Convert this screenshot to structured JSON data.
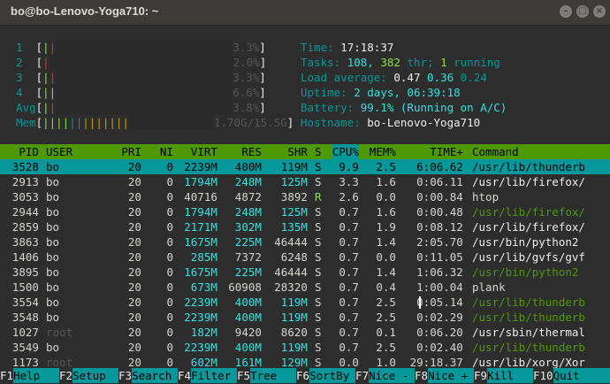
{
  "window": {
    "title": "bo@bo-Lenovo-Yoga710: ~"
  },
  "meters": {
    "cpu1": {
      "label": "1",
      "value": "3.3%"
    },
    "cpu2": {
      "label": "2",
      "value": "2.0%"
    },
    "cpu3": {
      "label": "3",
      "value": "3.3%"
    },
    "cpu4": {
      "label": "4",
      "value": "6.6%"
    },
    "avg": {
      "label": "Avg",
      "value": "3.8%"
    },
    "mem": {
      "label": "Mem",
      "value": "1.70G/15.5G"
    }
  },
  "info": {
    "time_label": "Time:",
    "time": "17:18:37",
    "tasks_label": "Tasks:",
    "tasks": "108,",
    "thr": "382",
    "thr_label": "thr;",
    "running": "1",
    "running_label": "running",
    "load_label": "Load average:",
    "load1": "0.47",
    "load5": "0.36",
    "load15": "0.24",
    "uptime_label": "Uptime:",
    "uptime": "2 days, 06:39:18",
    "battery_label": "Battery:",
    "battery": "99.1% (Running on A/C)",
    "host_label": "Hostname:",
    "host": "bo-Lenovo-Yoga710"
  },
  "table": {
    "headers": [
      "PID",
      "USER",
      "PRI",
      "NI",
      "VIRT",
      "RES",
      "SHR",
      "S",
      "CPU%",
      "MEM%",
      "TIME+",
      "Command"
    ],
    "rows": [
      [
        "3528",
        "bo",
        "20",
        "0",
        "2239M",
        "400M",
        "119M",
        "S",
        "9.9",
        "2.5",
        "6:06.62",
        "/usr/lib/thunderb"
      ],
      [
        "2913",
        "bo",
        "20",
        "0",
        "1794M",
        "248M",
        "125M",
        "S",
        "3.3",
        "1.6",
        "0:06.11",
        "/usr/lib/firefox/"
      ],
      [
        "3053",
        "bo",
        "20",
        "0",
        "40716",
        "4872",
        "3892",
        "R",
        "2.6",
        "0.0",
        "0:00.84",
        "htop"
      ],
      [
        "2944",
        "bo",
        "20",
        "0",
        "1794M",
        "248M",
        "125M",
        "S",
        "0.7",
        "1.6",
        "0:00.48",
        "/usr/lib/firefox/"
      ],
      [
        "2859",
        "bo",
        "20",
        "0",
        "2171M",
        "302M",
        "135M",
        "S",
        "0.7",
        "1.9",
        "0:08.12",
        "/usr/lib/firefox/"
      ],
      [
        "3863",
        "bo",
        "20",
        "0",
        "1675M",
        "225M",
        "46444",
        "S",
        "0.7",
        "1.4",
        "2:05.70",
        "/usr/bin/python2"
      ],
      [
        "1406",
        "bo",
        "20",
        "0",
        "285M",
        "7372",
        "6248",
        "S",
        "0.7",
        "0.0",
        "0:11.05",
        "/usr/lib/gvfs/gvf"
      ],
      [
        "3895",
        "bo",
        "20",
        "0",
        "1675M",
        "225M",
        "46444",
        "S",
        "0.7",
        "1.4",
        "1:06.32",
        "/usr/bin/python2"
      ],
      [
        "1500",
        "bo",
        "20",
        "0",
        "673M",
        "60908",
        "28320",
        "S",
        "0.7",
        "0.4",
        "1:00.04",
        "plank"
      ],
      [
        "3554",
        "bo",
        "20",
        "0",
        "2239M",
        "400M",
        "119M",
        "S",
        "0.7",
        "2.5",
        "0:05.14",
        "/usr/lib/thunderb"
      ],
      [
        "3548",
        "bo",
        "20",
        "0",
        "2239M",
        "400M",
        "119M",
        "S",
        "0.7",
        "2.5",
        "0:02.29",
        "/usr/lib/thunderb"
      ],
      [
        "1027",
        "root",
        "20",
        "0",
        "182M",
        "9420",
        "8620",
        "S",
        "0.7",
        "0.1",
        "0:06.20",
        "/usr/sbin/thermal"
      ],
      [
        "3549",
        "bo",
        "20",
        "0",
        "2239M",
        "400M",
        "119M",
        "S",
        "0.7",
        "2.5",
        "0:02.40",
        "/usr/lib/thunderb"
      ],
      [
        "1173",
        "root",
        "20",
        "0",
        "602M",
        "161M",
        "129M",
        "S",
        "0.0",
        "1.0",
        "29:18.37",
        "/usr/lib/xorg/Xor"
      ]
    ]
  },
  "fkeys": [
    {
      "key": "F1",
      "label": "Help"
    },
    {
      "key": "F2",
      "label": "Setup"
    },
    {
      "key": "F3",
      "label": "Search"
    },
    {
      "key": "F4",
      "label": "Filter"
    },
    {
      "key": "F5",
      "label": "Tree"
    },
    {
      "key": "F6",
      "label": "SortBy"
    },
    {
      "key": "F7",
      "label": "Nice -"
    },
    {
      "key": "F8",
      "label": "Nice +"
    },
    {
      "key": "F9",
      "label": "Kill"
    },
    {
      "key": "F10",
      "label": "Quit"
    }
  ],
  "colors": {
    "header_bg": "#4e9a06",
    "selected_bg": "#06989a",
    "accent": "#34e2e2"
  }
}
